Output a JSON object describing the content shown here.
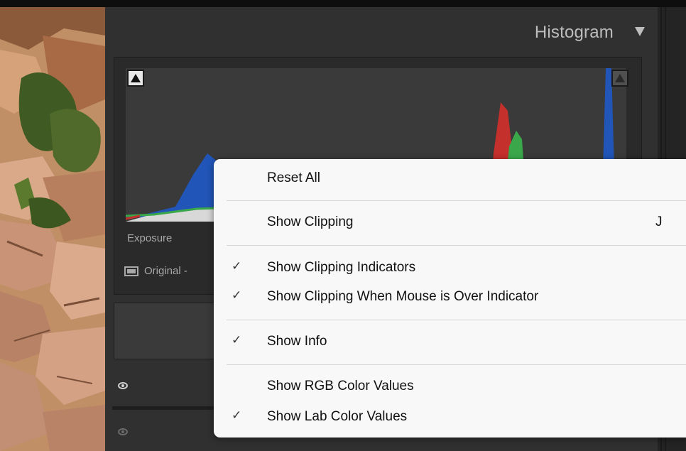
{
  "panel": {
    "title": "Histogram",
    "exposure_label": "Exposure",
    "original_label": "Original -"
  },
  "icons": {
    "collapse": "triangle-down-icon",
    "shadow_clip": "triangle-up-icon",
    "highlight_clip": "triangle-up-icon",
    "view": "before-after-view-icon",
    "visibility": "eye-icon",
    "check": "checkmark-icon"
  },
  "colors": {
    "panel_bg": "#303030",
    "histogram_bg": "#3a3a3a",
    "red_channel": "#c4302b",
    "green_channel": "#3aa84a",
    "blue_channel": "#2156b8",
    "menu_bg": "#f8f8f8"
  },
  "context_menu": {
    "items": [
      {
        "label": "Reset All",
        "checked": false,
        "shortcut": "",
        "check": ""
      },
      {
        "label": "Show Clipping",
        "checked": false,
        "shortcut": "J",
        "check": ""
      },
      {
        "label": "Show Clipping Indicators",
        "checked": true,
        "shortcut": "",
        "check": "✓"
      },
      {
        "label": "Show Clipping When Mouse is Over Indicator",
        "checked": true,
        "shortcut": "",
        "check": "✓"
      },
      {
        "label": "Show Info",
        "checked": true,
        "shortcut": "",
        "check": "✓"
      },
      {
        "label": "Show RGB Color Values",
        "checked": false,
        "shortcut": "",
        "check": ""
      },
      {
        "label": "Show Lab Color Values",
        "checked": true,
        "shortcut": "",
        "check": "✓"
      }
    ]
  }
}
